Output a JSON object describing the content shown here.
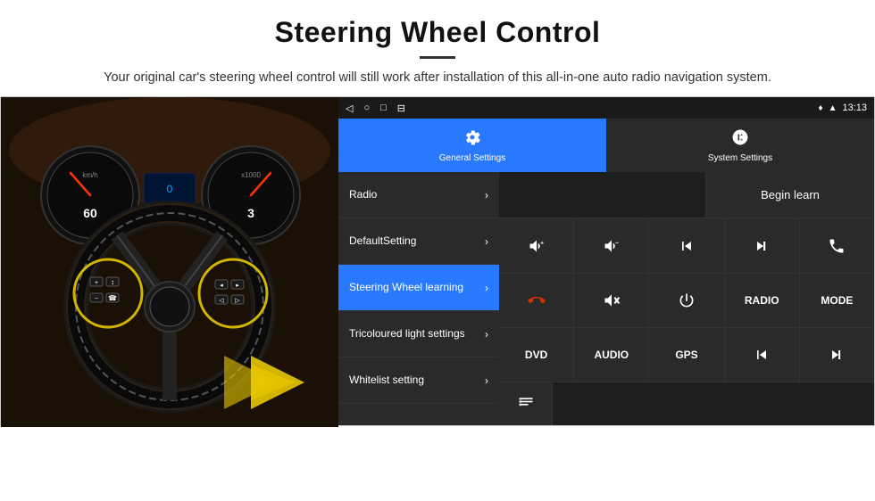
{
  "header": {
    "title": "Steering Wheel Control",
    "description": "Your original car's steering wheel control will still work after installation of this all-in-one auto radio navigation system."
  },
  "status_bar": {
    "time": "13:13",
    "icons": [
      "◁",
      "○",
      "□",
      "⊟"
    ]
  },
  "tabs": [
    {
      "id": "general",
      "label": "General Settings",
      "active": true
    },
    {
      "id": "system",
      "label": "System Settings",
      "active": false
    }
  ],
  "menu": [
    {
      "id": "radio",
      "label": "Radio",
      "active": false
    },
    {
      "id": "default",
      "label": "DefaultSetting",
      "active": false
    },
    {
      "id": "steering",
      "label": "Steering Wheel learning",
      "active": true
    },
    {
      "id": "tricoloured",
      "label": "Tricoloured light settings",
      "active": false
    },
    {
      "id": "whitelist",
      "label": "Whitelist setting",
      "active": false
    }
  ],
  "begin_learn_label": "Begin learn",
  "control_buttons": [
    [
      "vol+",
      "vol-",
      "prev",
      "next",
      "phone"
    ],
    [
      "hangup",
      "mute",
      "power",
      "RADIO",
      "MODE"
    ],
    [
      "DVD",
      "AUDIO",
      "GPS",
      "src-prev",
      "src-next"
    ]
  ]
}
